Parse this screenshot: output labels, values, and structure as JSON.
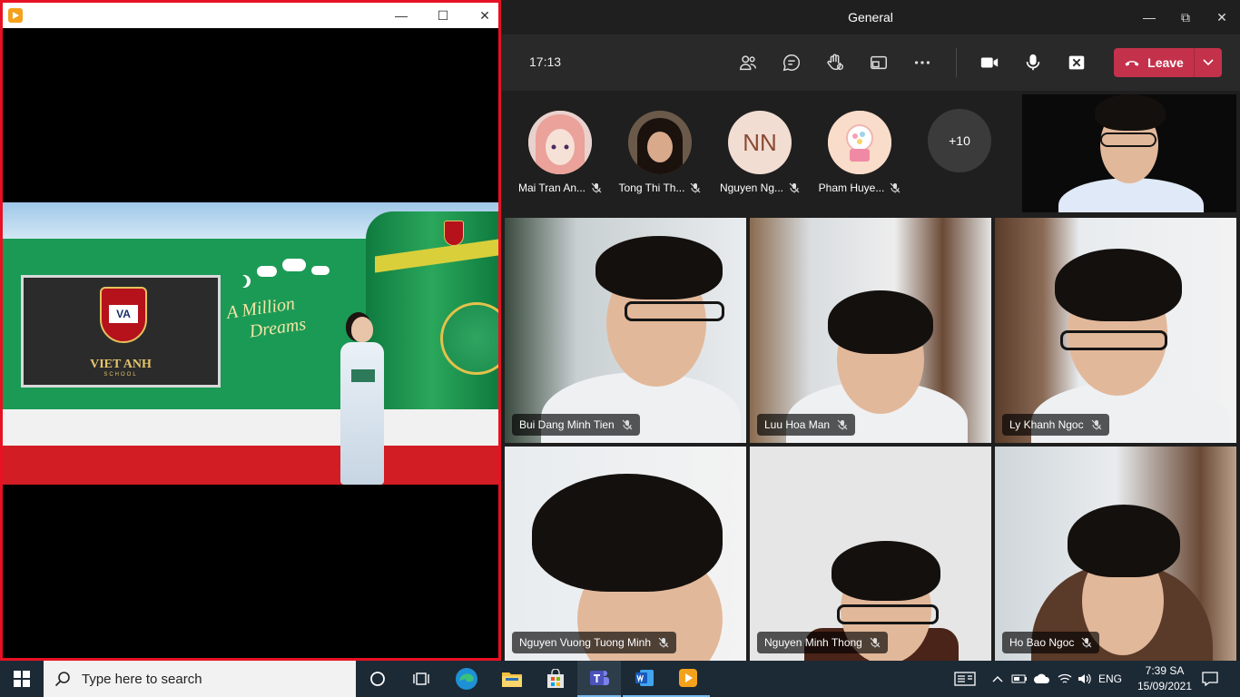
{
  "player": {
    "title": "",
    "board_name": "VIET ANH",
    "board_sub": "SCHOOL",
    "board_logo": "VA",
    "slogan_line1": "A Million",
    "slogan_line2": "Dreams"
  },
  "teams": {
    "title": "General",
    "timer": "17:13",
    "leave_label": "Leave",
    "accent_color": "#c4314b",
    "strip": [
      {
        "name": "Mai Tran An...",
        "avatar": "anime-avatar"
      },
      {
        "name": "Tong Thi Th...",
        "avatar": "photo-avatar"
      },
      {
        "name": "Nguyen Ng...",
        "avatar": "initials",
        "initials": "NN"
      },
      {
        "name": "Pham Huye...",
        "avatar": "gumball-avatar"
      }
    ],
    "overflow_count": "+10",
    "tiles": [
      {
        "name": "Bui Dang Minh Tien"
      },
      {
        "name": "Luu Hoa Man"
      },
      {
        "name": "Ly Khanh Ngoc"
      },
      {
        "name": "Nguyen Vuong Tuong Minh"
      },
      {
        "name": "Nguyen Minh Thong"
      },
      {
        "name": "Ho Bao Ngoc"
      }
    ]
  },
  "taskbar": {
    "search_placeholder": "Type here to search",
    "language": "ENG",
    "time": "7:39 SA",
    "date": "15/09/2021"
  }
}
